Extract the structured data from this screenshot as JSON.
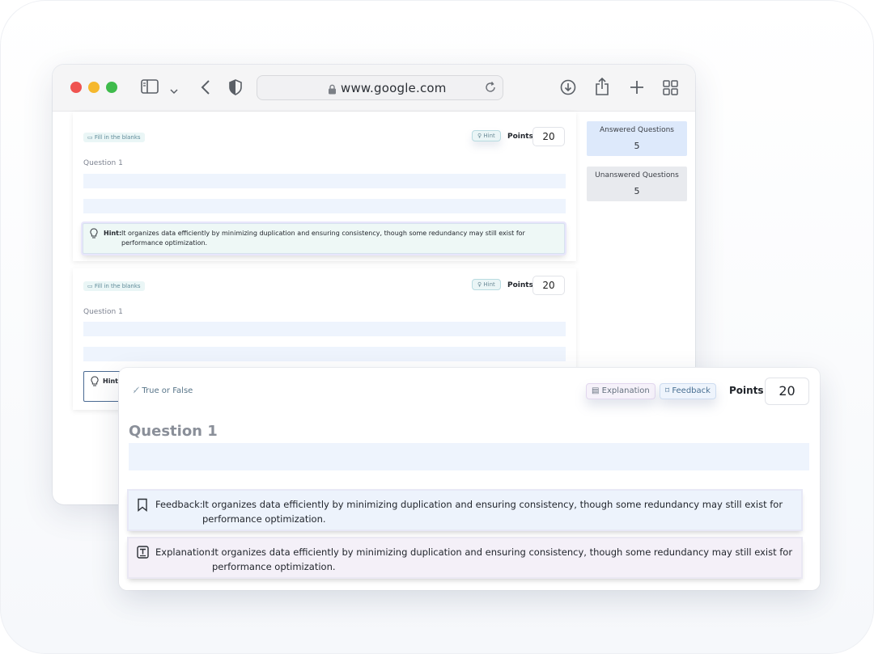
{
  "browser": {
    "url": "www.google.com"
  },
  "questions": [
    {
      "type_tag": "Fill in the blanks",
      "hint_label": "Hint",
      "points_label": "Points",
      "points": "20",
      "question_label": "Question 1",
      "hint": {
        "head": "Hint:",
        "text": "It organizes data efficiently by minimizing duplication and ensuring consistency, though some redundancy may still exist for performance optimization."
      }
    },
    {
      "type_tag": "Fill in the blanks",
      "hint_label": "Hint",
      "points_label": "Points",
      "points": "20",
      "question_label": "Question 1",
      "hint": {
        "head": "Hint:"
      }
    }
  ],
  "stats": {
    "answered_label": "Answered Questions",
    "answered": "5",
    "unanswered_label": "Unanswered Questions",
    "unanswered": "5"
  },
  "front_card": {
    "type_tag": "True or False",
    "explanation_label": "Explanation",
    "feedback_label": "Feedback",
    "points_label": "Points",
    "points": "20",
    "question_label": "Question 1",
    "feedback": {
      "head": "Feedback:",
      "text": "It organizes data efficiently by minimizing duplication and ensuring consistency, though some redundancy may still exist for performance optimization."
    },
    "explanation": {
      "head": "Explanation:",
      "text": "It organizes data efficiently by minimizing duplication and ensuring consistency, though some redundancy may still exist for performance optimization."
    }
  },
  "colors": {
    "accent_blue": "#dde9fb",
    "neutral": "#e8eaee",
    "traffic_red": "#ef5350",
    "traffic_yellow": "#f5b82e",
    "traffic_green": "#3fbb4c"
  }
}
